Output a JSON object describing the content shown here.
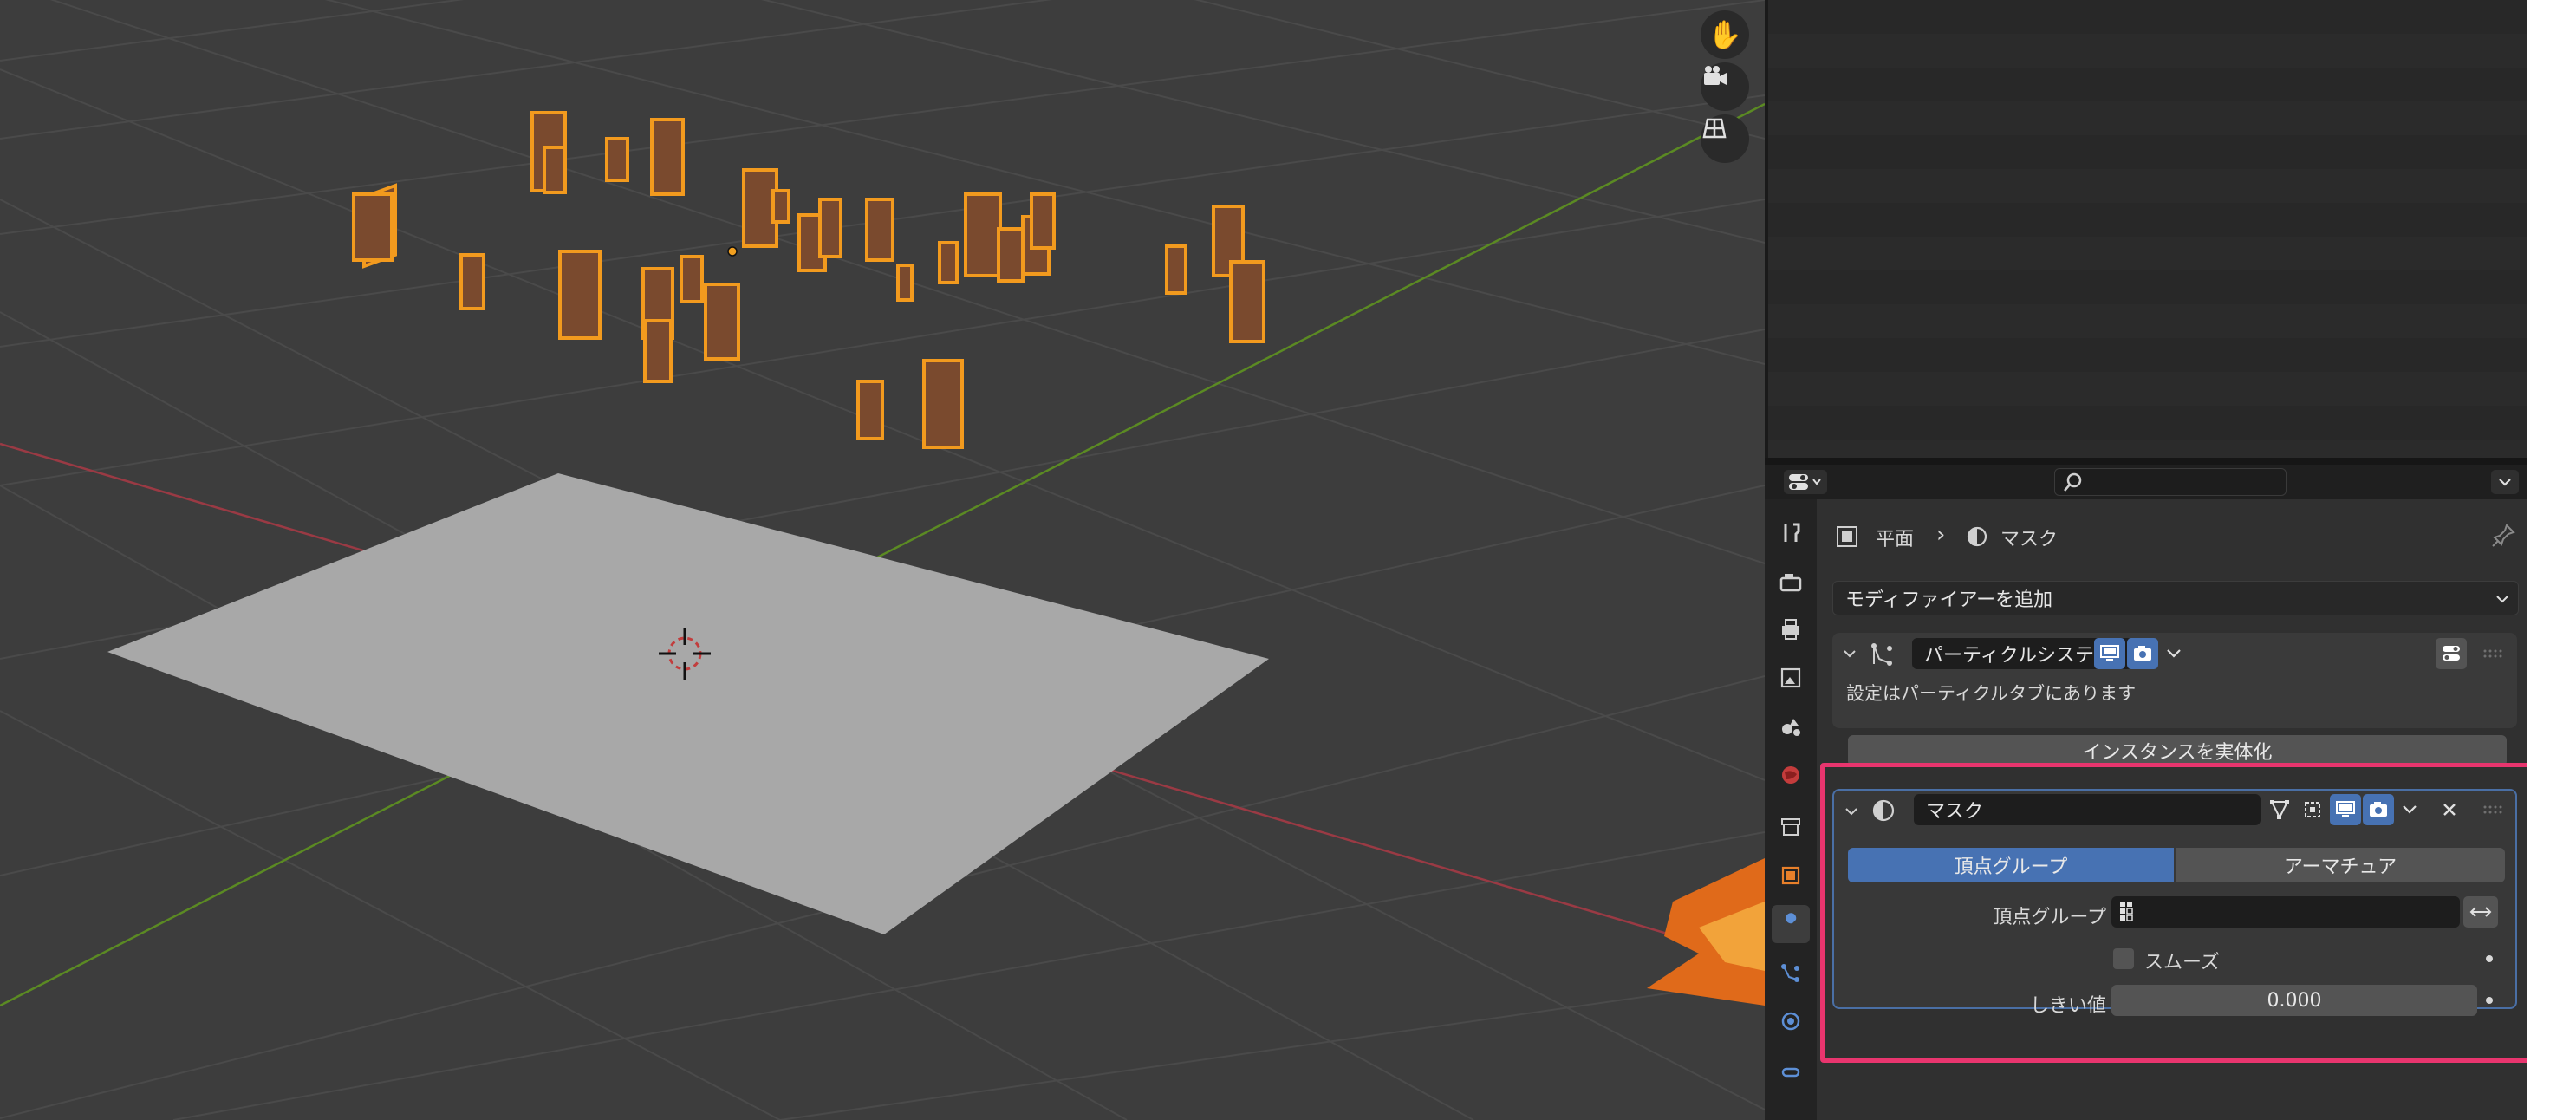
{
  "viewport": {
    "nav": {
      "pan_icon": "hand-icon",
      "camera_icon": "camera-icon",
      "ortho_icon": "grid-icon"
    }
  },
  "properties": {
    "editor_type_icon": "properties-editor-icon",
    "search": {
      "placeholder": ""
    },
    "breadcrumb": {
      "object": "平面",
      "separator": "›",
      "modifier": "マスク"
    },
    "add_modifier": "モディファイアーを追加",
    "modifiers": [
      {
        "name": "パーティクルシステム",
        "info": "設定はパーティクルタブにあります",
        "action": "インスタンスを実体化"
      },
      {
        "name": "マスク",
        "mode_tabs": [
          "頂点グループ",
          "アーマチュア"
        ],
        "active_mode": "頂点グループ",
        "vertex_group_label": "頂点グループ",
        "vertex_group_value": "",
        "smooth_label": "スムーズ",
        "smooth_checked": false,
        "threshold_label": "しきい値",
        "threshold_value": "0.000"
      }
    ]
  },
  "colors": {
    "accent": "#4772b3",
    "highlight": "#e8356e",
    "viewport_bg": "#3d3d3d",
    "panel_bg": "#303030"
  }
}
